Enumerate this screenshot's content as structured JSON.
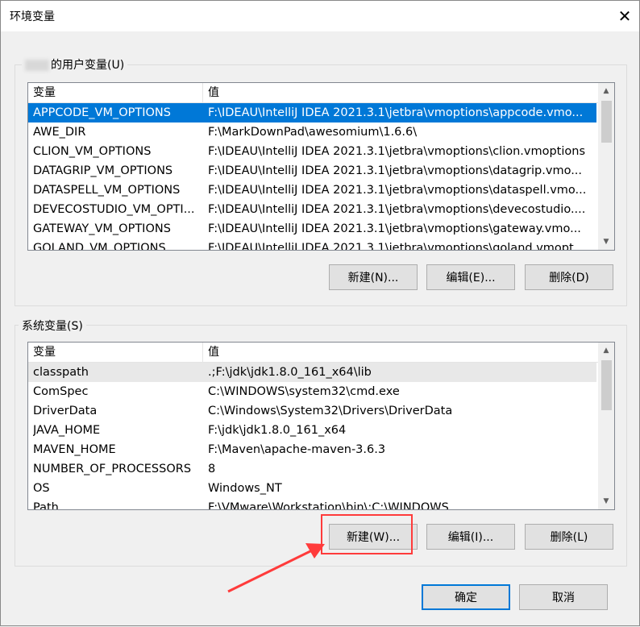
{
  "window": {
    "title": "环境变量"
  },
  "user_vars": {
    "group_label": "的用户变量(U)",
    "header": {
      "name": "变量",
      "value": "值"
    },
    "rows": [
      {
        "name": "APPCODE_VM_OPTIONS",
        "value": "F:\\IDEAU\\IntelliJ IDEA 2021.3.1\\jetbra\\vmoptions\\appcode.vmo..."
      },
      {
        "name": "AWE_DIR",
        "value": "F:\\MarkDownPad\\awesomium\\1.6.6\\"
      },
      {
        "name": "CLION_VM_OPTIONS",
        "value": "F:\\IDEAU\\IntelliJ IDEA 2021.3.1\\jetbra\\vmoptions\\clion.vmoptions"
      },
      {
        "name": "DATAGRIP_VM_OPTIONS",
        "value": "F:\\IDEAU\\IntelliJ IDEA 2021.3.1\\jetbra\\vmoptions\\datagrip.vmo..."
      },
      {
        "name": "DATASPELL_VM_OPTIONS",
        "value": "F:\\IDEAU\\IntelliJ IDEA 2021.3.1\\jetbra\\vmoptions\\dataspell.vmo..."
      },
      {
        "name": "DEVECOSTUDIO_VM_OPTI...",
        "value": "F:\\IDEAU\\IntelliJ IDEA 2021.3.1\\jetbra\\vmoptions\\devecostudio...."
      },
      {
        "name": "GATEWAY_VM_OPTIONS",
        "value": "F:\\IDEAU\\IntelliJ IDEA 2021.3.1\\jetbra\\vmoptions\\gateway.vmo..."
      },
      {
        "name": "GOLAND_VM_OPTIONS",
        "value": "F:\\IDEAU\\IntelliJ IDEA 2021.3.1\\jetbra\\vmoptions\\goland.vmopt..."
      }
    ],
    "buttons": {
      "new": "新建(N)...",
      "edit": "编辑(E)...",
      "delete": "删除(D)"
    }
  },
  "system_vars": {
    "group_label": "系统变量(S)",
    "header": {
      "name": "变量",
      "value": "值"
    },
    "rows": [
      {
        "name": "classpath",
        "value": ".;F:\\jdk\\jdk1.8.0_161_x64\\lib"
      },
      {
        "name": "ComSpec",
        "value": "C:\\WINDOWS\\system32\\cmd.exe"
      },
      {
        "name": "DriverData",
        "value": "C:\\Windows\\System32\\Drivers\\DriverData"
      },
      {
        "name": "JAVA_HOME",
        "value": "F:\\jdk\\jdk1.8.0_161_x64"
      },
      {
        "name": "MAVEN_HOME",
        "value": "F:\\Maven\\apache-maven-3.6.3"
      },
      {
        "name": "NUMBER_OF_PROCESSORS",
        "value": "8"
      },
      {
        "name": "OS",
        "value": "Windows_NT"
      },
      {
        "name": "Path",
        "value": "F:\\VMware\\Workstation\\bin\\;C:\\WINDOWS..."
      }
    ],
    "buttons": {
      "new": "新建(W)...",
      "edit": "编辑(I)...",
      "delete": "删除(L)"
    }
  },
  "dialog_buttons": {
    "ok": "确定",
    "cancel": "取消"
  },
  "colors": {
    "selection": "#0078d7",
    "highlight": "#ff3b3b"
  }
}
